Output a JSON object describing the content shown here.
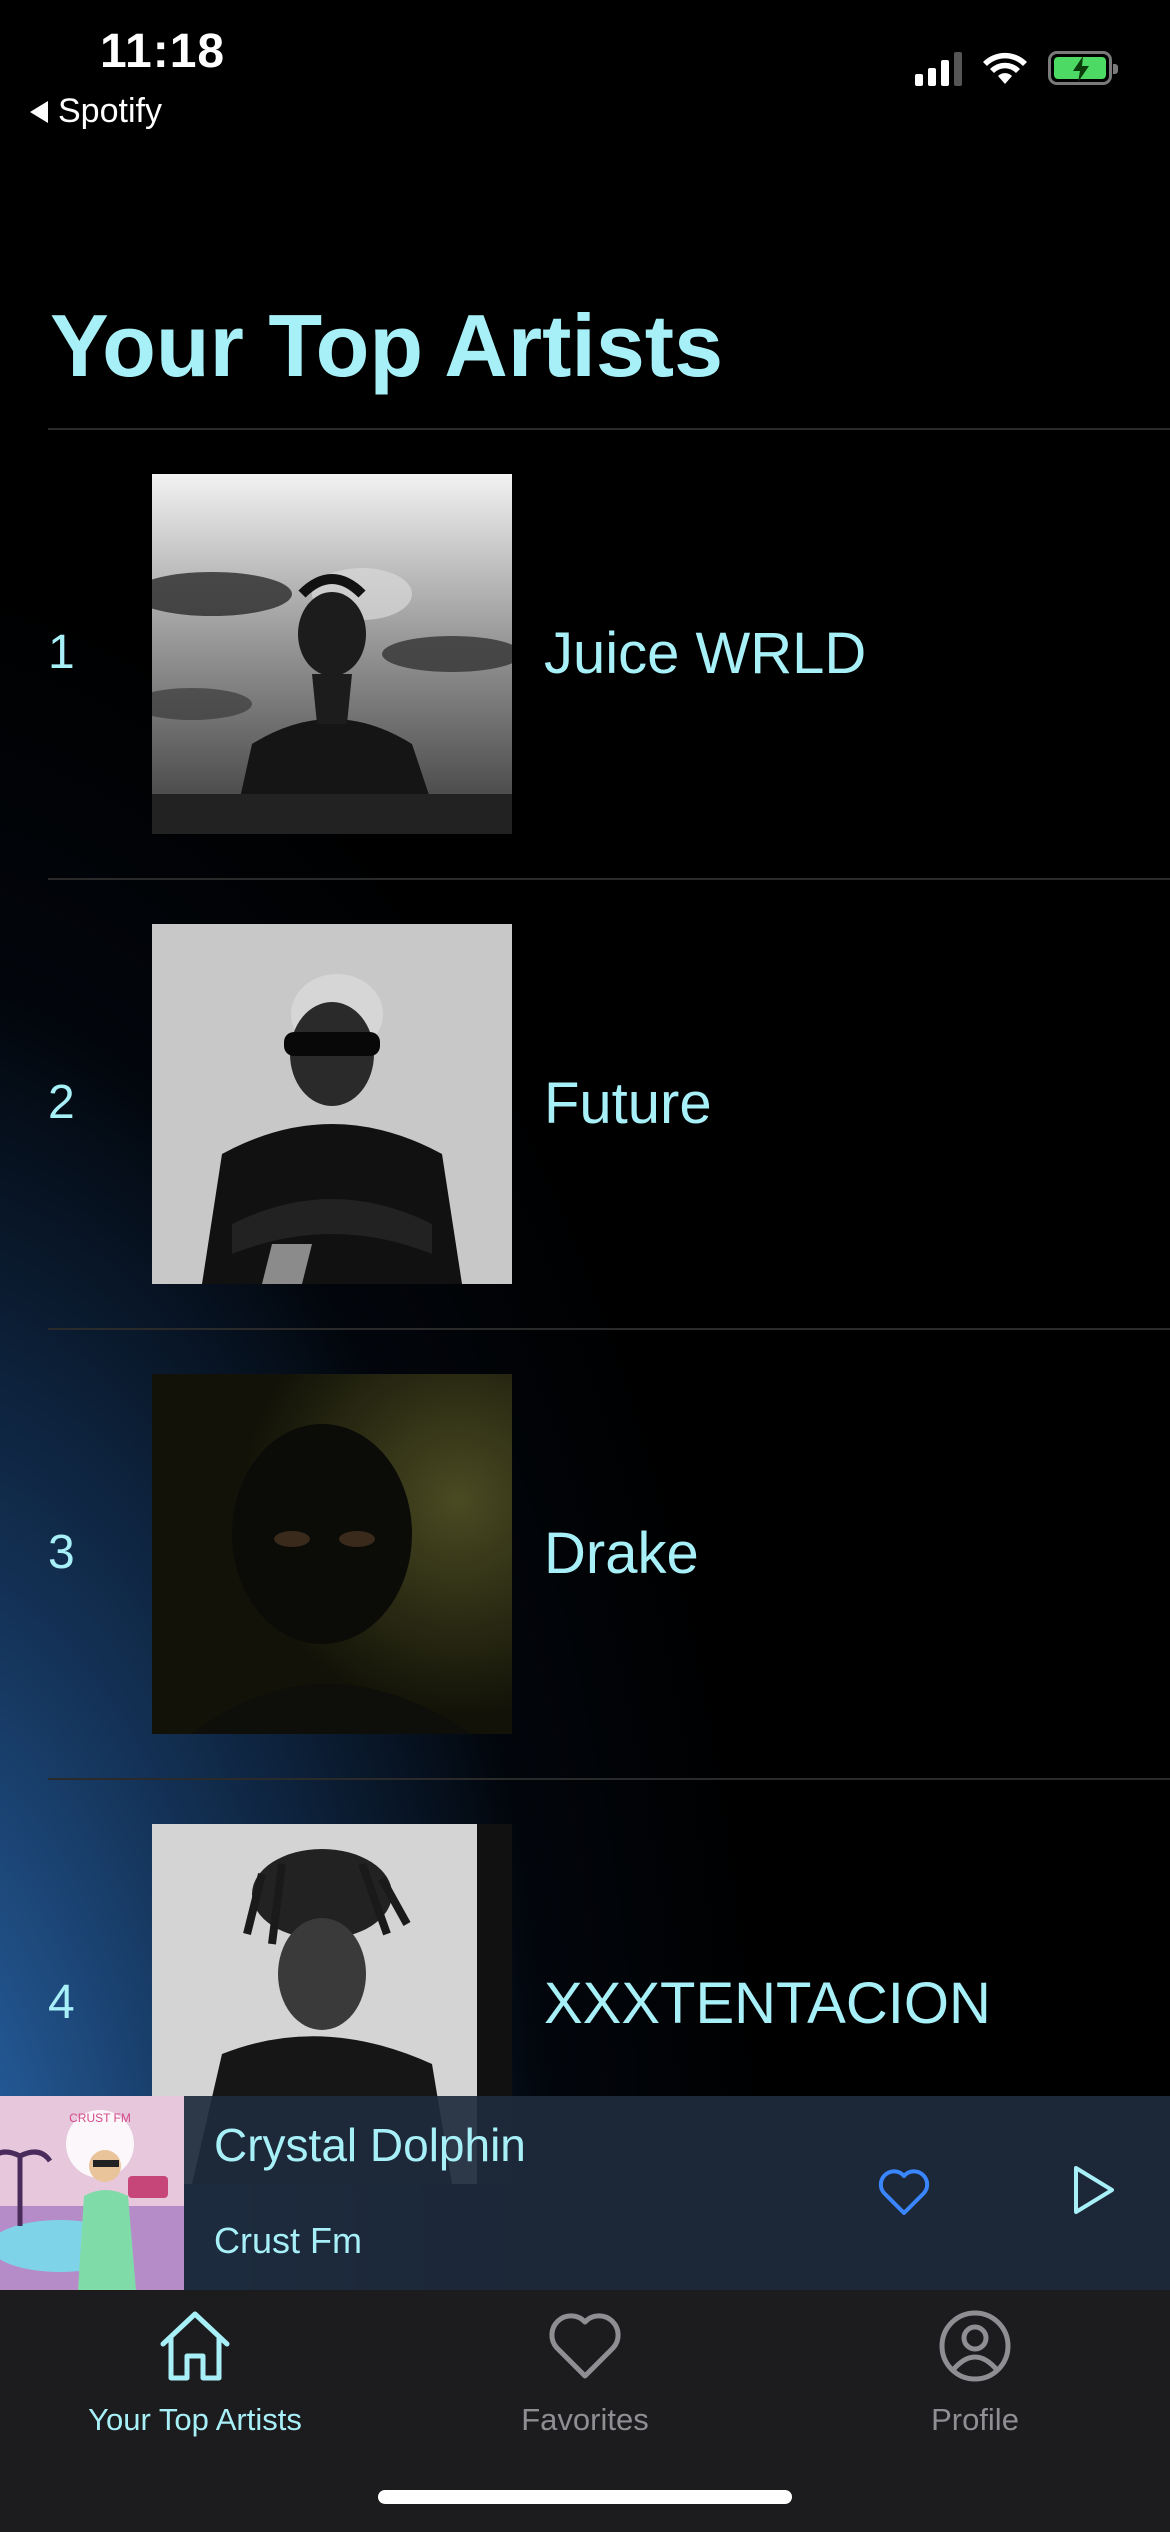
{
  "status_bar": {
    "time": "11:18",
    "back_label": "Spotify",
    "icons": [
      "cellular-signal-icon",
      "wifi-icon",
      "battery-charging-icon"
    ]
  },
  "page": {
    "title": "Your Top Artists"
  },
  "artists": [
    {
      "rank": "1",
      "name": "Juice WRLD",
      "artwork": "black-and-white-portrait-smoke-clouds"
    },
    {
      "rank": "2",
      "name": "Future",
      "artwork": "black-and-white-portrait-sunglasses-leather-jacket"
    },
    {
      "rank": "3",
      "name": "Drake",
      "artwork": "dark-portrait-masked-face"
    },
    {
      "rank": "4",
      "name": "XXXTENTACION",
      "artwork": "black-and-white-portrait-dreadlocks"
    }
  ],
  "now_playing": {
    "title": "Crystal Dolphin",
    "artist": "Crust Fm",
    "artwork_text": "CRUST FM",
    "favorite_icon": "heart-outline-icon",
    "play_icon": "play-outline-icon"
  },
  "tabs": [
    {
      "label": "Your Top Artists",
      "icon": "home-icon",
      "active": true
    },
    {
      "label": "Favorites",
      "icon": "heart-icon",
      "active": false
    },
    {
      "label": "Profile",
      "icon": "person-circle-icon",
      "active": false
    }
  ],
  "colors": {
    "accent_text": "#a8f0f8",
    "background": "#000000",
    "glow_blue": "#3076c4",
    "player_background": "#1e2a3c",
    "tab_bar_background": "#1c1c1e",
    "favorite_icon": "#3a86ff",
    "battery_green": "#4cd964",
    "inactive_tab": "#8e8e93"
  }
}
